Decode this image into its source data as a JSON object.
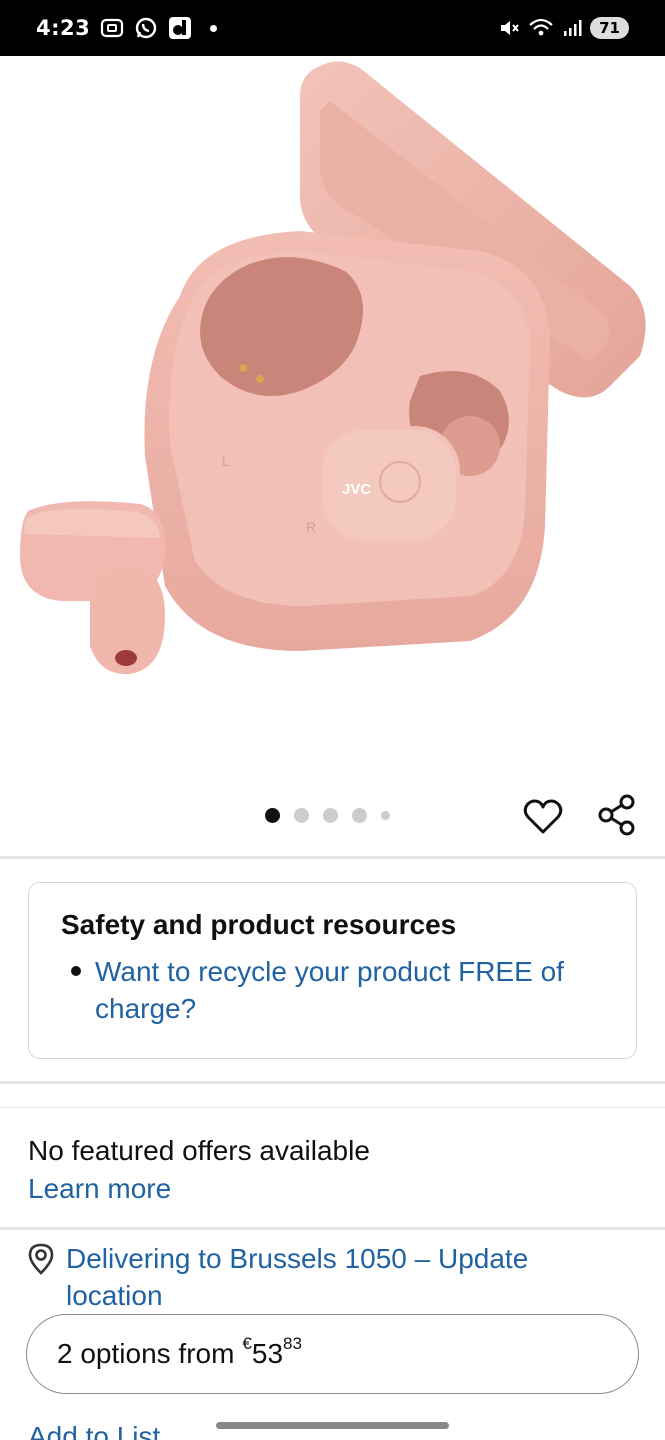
{
  "status_bar": {
    "time": "4:23",
    "battery": "71",
    "icons": [
      "screenshot-icon",
      "whatsapp-icon",
      "app-d-icon",
      "notification-dot-icon",
      "mute-icon",
      "wifi-icon",
      "signal-icon",
      "battery-icon"
    ]
  },
  "product": {
    "image": "pink-true-wireless-earbuds-with-open-charging-case",
    "image_count": 5,
    "active_image": 1,
    "brand_mark": "JVC",
    "case_label_left": "L",
    "case_label_right": "R"
  },
  "safety": {
    "title": "Safety and product resources",
    "link": "Want to recycle your product FREE of charge?"
  },
  "offers": {
    "message": "No featured offers available",
    "learn_more": "Learn more"
  },
  "delivery": {
    "text": "Delivering to Brussels 1050 – Update location"
  },
  "options": {
    "label": "2 options from",
    "currency": "€",
    "whole": "53",
    "fraction": "83"
  },
  "add_to_list": "Add to List",
  "colors": {
    "link": "#2162a1",
    "text": "#0f1111",
    "divider": "#e3e6e6",
    "product_pink": "#f0b7ad"
  }
}
